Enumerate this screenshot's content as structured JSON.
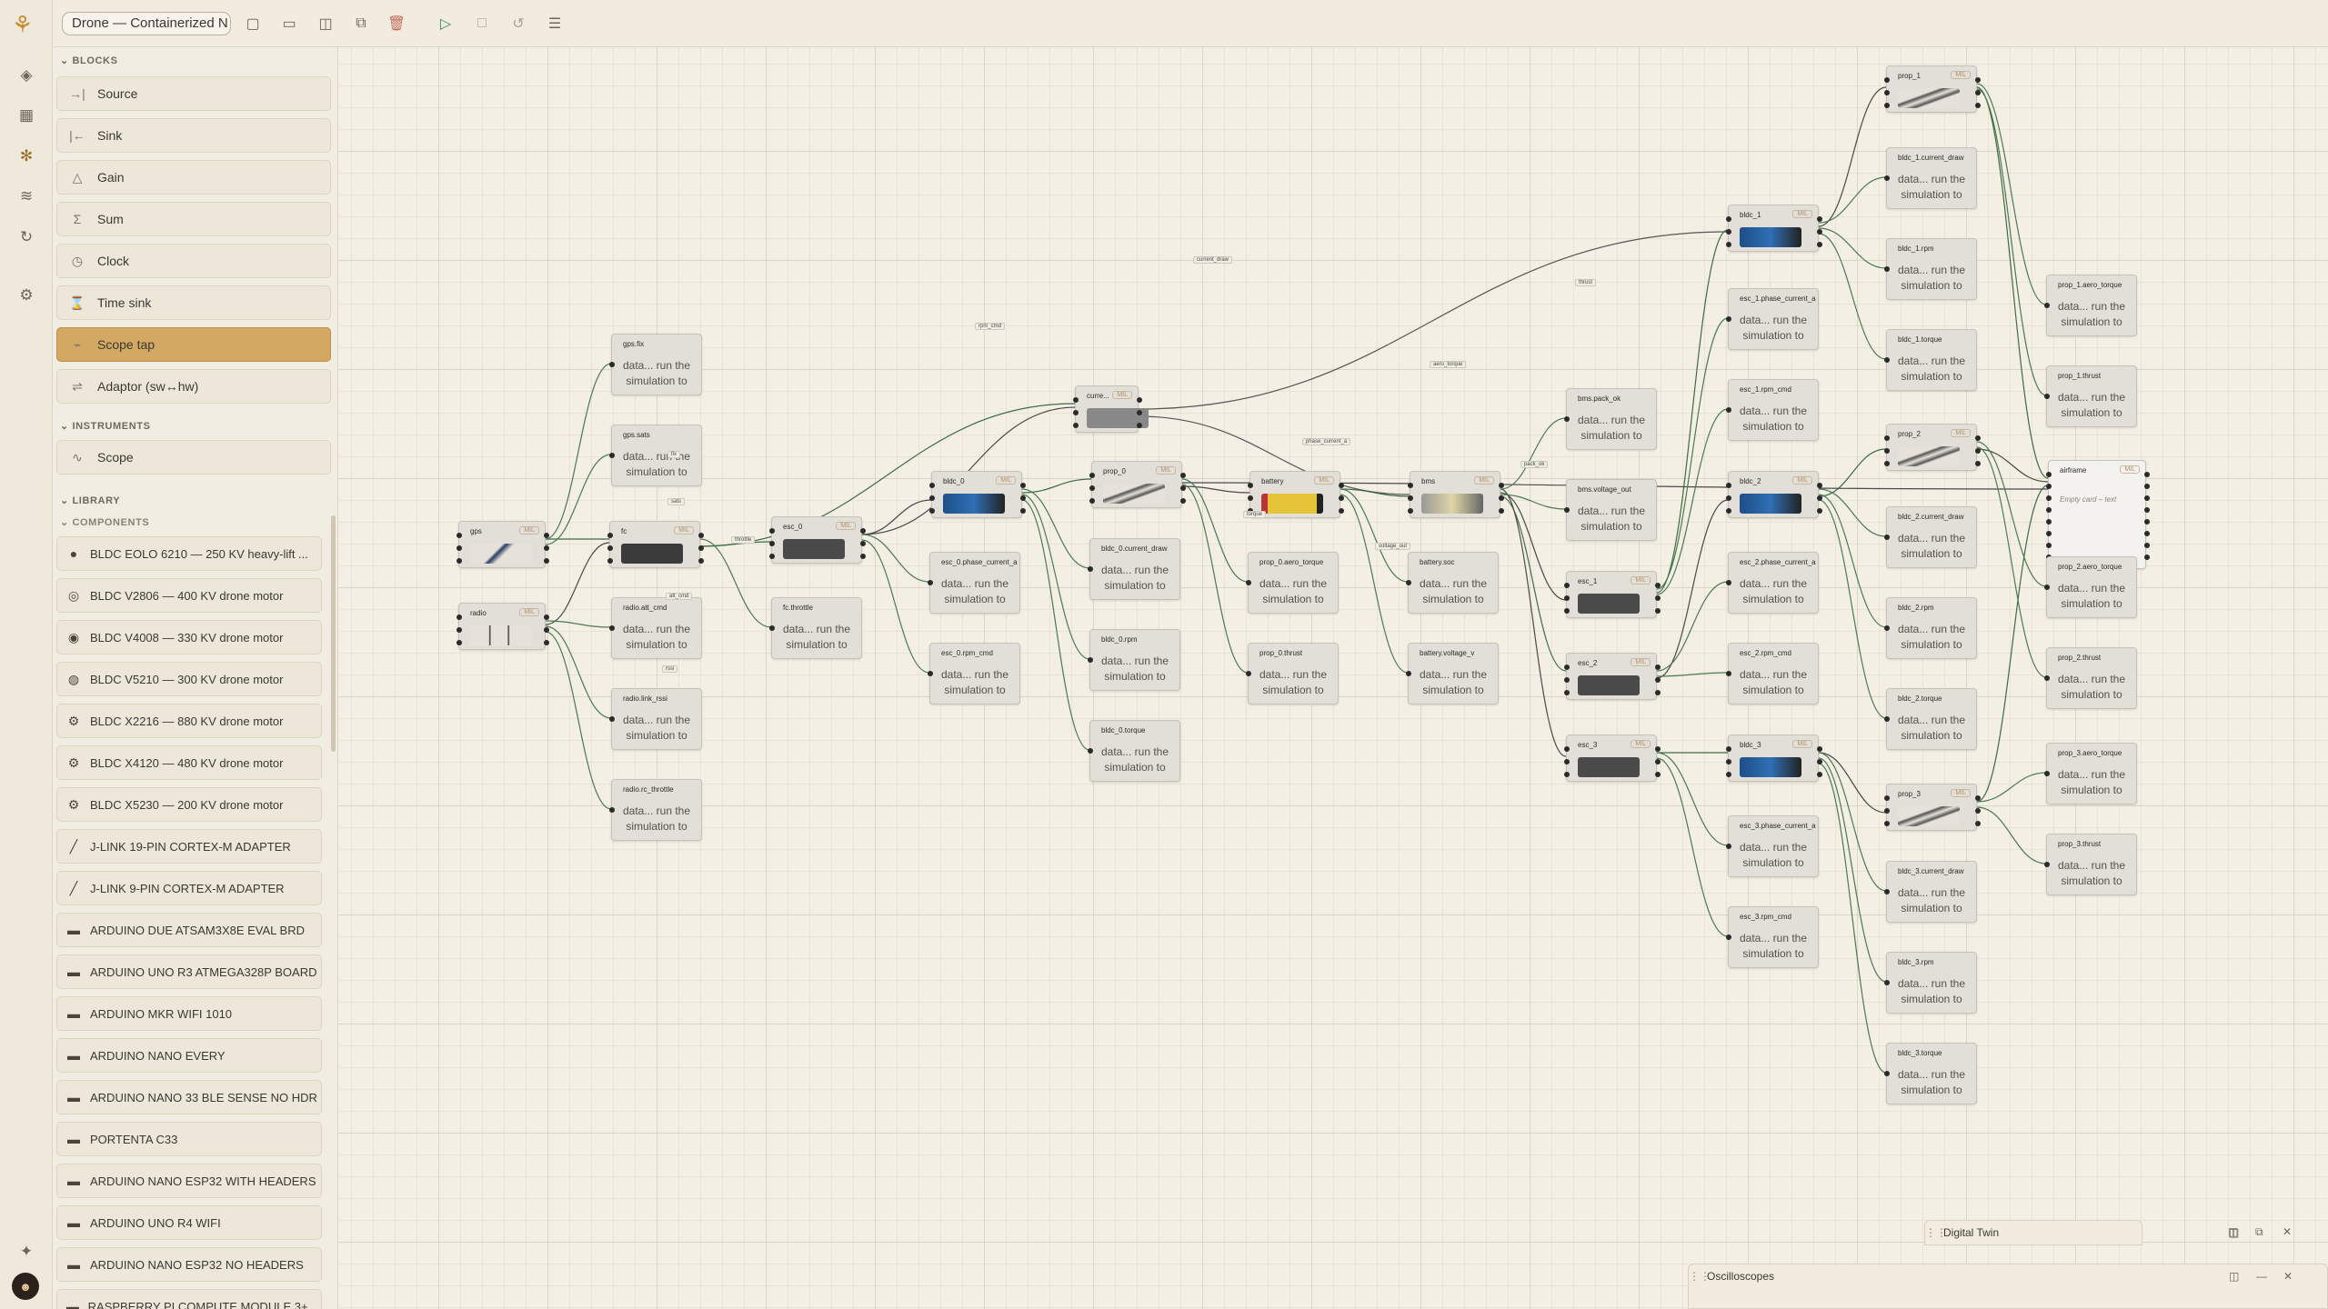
{
  "app": {
    "document_title": "Drone — Containerized N"
  },
  "rail": {
    "icons": [
      "layers-icon",
      "grid-icon",
      "blocks-icon",
      "tune-icon",
      "loop-icon",
      "settings-icon"
    ],
    "bottom": [
      "sparkle-icon",
      "avatar"
    ]
  },
  "toolbar": {
    "buttons": [
      "new-file",
      "open-folder",
      "save",
      "duplicate",
      "delete",
      "run",
      "stop",
      "reset",
      "menu"
    ]
  },
  "sidebar": {
    "blocks_title": "BLOCKS",
    "blocks": [
      {
        "label": "Source",
        "icon": "→|"
      },
      {
        "label": "Sink",
        "icon": "|←"
      },
      {
        "label": "Gain",
        "icon": "△"
      },
      {
        "label": "Sum",
        "icon": "Σ"
      },
      {
        "label": "Clock",
        "icon": "◷"
      },
      {
        "label": "Time sink",
        "icon": "⌛"
      },
      {
        "label": "Scope tap",
        "icon": "⌁",
        "selected": true
      },
      {
        "label": "Adaptor (sw↔hw)",
        "icon": "⇌"
      }
    ],
    "instruments_title": "INSTRUMENTS",
    "instruments": [
      {
        "label": "Scope",
        "icon": "∿"
      }
    ],
    "library_title": "LIBRARY",
    "components_title": "COMPONENTS",
    "components": [
      "BLDC EOLO 6210 — 250 KV heavy-lift ...",
      "BLDC V2806 — 400 KV drone motor",
      "BLDC V4008 — 330 KV drone motor",
      "BLDC V5210 — 300 KV drone motor",
      "BLDC X2216 — 880 KV drone motor",
      "BLDC X4120 — 480 KV drone motor",
      "BLDC X5230 — 200 KV drone motor",
      "J-LINK 19-PIN CORTEX-M ADAPTER",
      "J-LINK 9-PIN CORTEX-M ADAPTER",
      "ARDUINO DUE ATSAM3X8E EVAL BRD",
      "ARDUINO UNO R3 ATMEGA328P BOARD",
      "ARDUINO MKR WIFI 1010",
      "ARDUINO NANO EVERY",
      "ARDUINO NANO 33 BLE SENSE NO HDR",
      "PORTENTA C33",
      "ARDUINO NANO ESP32 WITH HEADERS",
      "ARDUINO UNO R4 WIFI",
      "ARDUINO NANO ESP32 NO HEADERS",
      "RASPBERRY PI COMPUTE MODULE 3+ ..."
    ]
  },
  "canvas": {
    "data_text": "data... run the simulation to",
    "tag_text": "MIL",
    "device_nodes": [
      {
        "id": "gps",
        "title": "gps"
      },
      {
        "id": "radio",
        "title": "radio"
      },
      {
        "id": "fc",
        "title": "fc"
      },
      {
        "id": "esc_0",
        "title": "esc_0"
      },
      {
        "id": "bldc_0",
        "title": "bldc_0"
      },
      {
        "id": "prop_0",
        "title": "prop_0"
      },
      {
        "id": "curr",
        "title": "curre..."
      },
      {
        "id": "battery",
        "title": "battery"
      },
      {
        "id": "bms",
        "title": "bms"
      },
      {
        "id": "esc_1",
        "title": "esc_1"
      },
      {
        "id": "esc_2",
        "title": "esc_2"
      },
      {
        "id": "esc_3",
        "title": "esc_3"
      },
      {
        "id": "bldc_1",
        "title": "bldc_1"
      },
      {
        "id": "bldc_2",
        "title": "bldc_2"
      },
      {
        "id": "bldc_3",
        "title": "bldc_3"
      },
      {
        "id": "prop_1",
        "title": "prop_1"
      },
      {
        "id": "prop_2",
        "title": "prop_2"
      },
      {
        "id": "prop_3",
        "title": "prop_3"
      },
      {
        "id": "airframe",
        "title": "airframe",
        "empty": "Empty card – text"
      }
    ],
    "scope_nodes": [
      "gps.fix",
      "gps.sats",
      "radio.att_cmd",
      "radio.link_rssi",
      "radio.rc_throttle",
      "fc.throttle",
      "esc_0.phase_current_a",
      "esc_0.rpm_cmd",
      "bldc_0.current_draw",
      "bldc_0.rpm",
      "bldc_0.torque",
      "prop_0.aero_torque",
      "prop_0.thrust",
      "battery.soc",
      "battery.voltage_v",
      "bms.pack_ok",
      "bms.voltage_out",
      "esc_1.phase_current_a",
      "esc_1.rpm_cmd",
      "esc_2.phase_current_a",
      "esc_2.rpm_cmd",
      "esc_3.phase_current_a",
      "esc_3.rpm_cmd",
      "bldc_1.current_draw",
      "bldc_1.rpm",
      "bldc_1.torque",
      "bldc_2.current_draw",
      "bldc_2.rpm",
      "bldc_2.torque",
      "bldc_3.current_draw",
      "bldc_3.rpm",
      "bldc_3.torque",
      "prop_1.aero_torque",
      "prop_1.thrust",
      "prop_2.aero_torque",
      "prop_2.thrust",
      "prop_3.aero_torque",
      "prop_3.thrust"
    ],
    "wire_labels": [
      "rpm_cmd",
      "current_draw",
      "phase_current_a",
      "thrust",
      "aero_torque",
      "torque",
      "voltage_out",
      "pack_ok",
      "throttle",
      "att_cmd",
      "rssi",
      "fix",
      "sats"
    ]
  },
  "panels": {
    "digital_twin": "Digital Twin",
    "oscilloscopes": "Oscilloscopes"
  }
}
